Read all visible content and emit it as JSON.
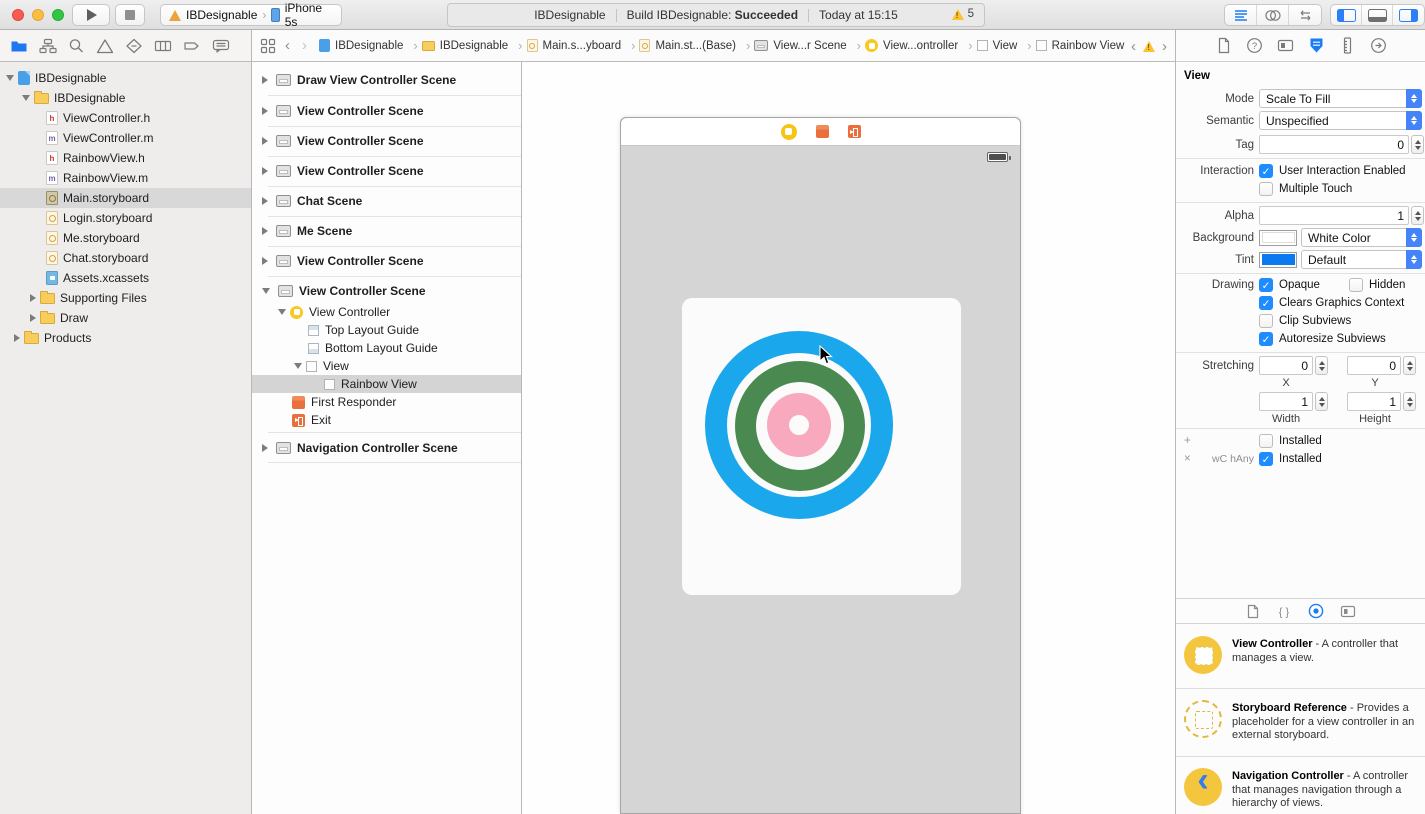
{
  "window": {
    "scheme_target": "IBDesignable",
    "scheme_device": "iPhone 5s",
    "status_project": "IBDesignable",
    "status_build": "Build IBDesignable:",
    "status_result": "Succeeded",
    "status_time": "Today at 15:15",
    "warning_count": "5"
  },
  "navigator": {
    "project": "IBDesignable",
    "group": "IBDesignable",
    "files": [
      "ViewController.h",
      "ViewController.m",
      "RainbowView.h",
      "RainbowView.m",
      "Main.storyboard",
      "Login.storyboard",
      "Me.storyboard",
      "Chat.storyboard",
      "Assets.xcassets"
    ],
    "folders": [
      "Supporting Files",
      "Draw"
    ],
    "products": "Products"
  },
  "jumpbar": {
    "crumbs": [
      "IBDesignable",
      "IBDesignable",
      "Main.s...yboard",
      "Main.st...(Base)",
      "View...r Scene",
      "View...ontroller",
      "View",
      "Rainbow View"
    ]
  },
  "outline": {
    "scenes": [
      "Draw View Controller Scene",
      "View Controller Scene",
      "View Controller Scene",
      "View Controller Scene",
      "Chat Scene",
      "Me Scene",
      "View Controller Scene"
    ],
    "expanded": {
      "label": "View Controller Scene",
      "view_controller": "View Controller",
      "top_layout_guide": "Top Layout Guide",
      "bottom_layout_guide": "Bottom Layout Guide",
      "view": "View",
      "rainbow_view": "Rainbow View",
      "first_responder": "First Responder",
      "exit": "Exit"
    },
    "nav_scene": "Navigation Controller Scene"
  },
  "inspector": {
    "title": "View",
    "mode_label": "Mode",
    "mode_value": "Scale To Fill",
    "semantic_label": "Semantic",
    "semantic_value": "Unspecified",
    "tag_label": "Tag",
    "tag_value": "0",
    "interaction_label": "Interaction",
    "user_interaction": "User Interaction Enabled",
    "user_interaction_checked": true,
    "multiple_touch": "Multiple Touch",
    "multiple_touch_checked": false,
    "alpha_label": "Alpha",
    "alpha_value": "1",
    "background_label": "Background",
    "background_value": "White Color",
    "tint_label": "Tint",
    "tint_value": "Default",
    "drawing_label": "Drawing",
    "opaque": "Opaque",
    "opaque_checked": true,
    "hidden": "Hidden",
    "hidden_checked": false,
    "clears": "Clears Graphics Context",
    "clears_checked": true,
    "clip": "Clip Subviews",
    "clip_checked": false,
    "autoresize": "Autoresize Subviews",
    "autoresize_checked": true,
    "stretching_label": "Stretching",
    "stretch_x": "0",
    "stretch_y": "0",
    "x_label": "X",
    "y_label": "Y",
    "stretch_w": "1",
    "stretch_h": "1",
    "width_label": "Width",
    "height_label": "Height",
    "plus": "+",
    "times": "×",
    "installed1": "Installed",
    "installed1_checked": false,
    "size_class": "wC hAny",
    "installed2": "Installed",
    "installed2_checked": true
  },
  "library": {
    "items": [
      {
        "title": "View Controller",
        "desc": "- A controller that manages a view."
      },
      {
        "title": "Storyboard Reference",
        "desc": "- Provides a placeholder for a view controller in an external storyboard."
      },
      {
        "title": "Navigation Controller",
        "desc": "- A controller that manages navigation through a hierarchy of views."
      }
    ]
  },
  "canvas": {
    "ring_colors": {
      "outer_blue": "#1AA7EB",
      "middle_green": "#4A8A51",
      "inner_pink": "#F9A9BD"
    },
    "background": "#D5D5D5"
  },
  "colors": {
    "accent_blue": "#1E80F8",
    "selection_gray": "#D8D8D8",
    "warning_yellow": "#FDC32E",
    "vc_yellow": "#F4C63D",
    "orange": "#E96F3C"
  }
}
